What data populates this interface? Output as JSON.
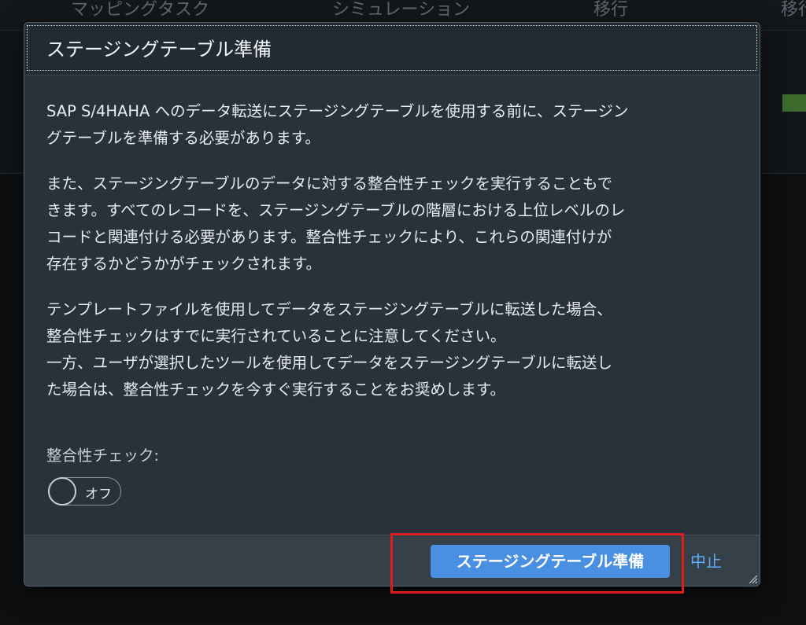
{
  "background": {
    "tabs": [
      "マッピングタスク",
      "シミュレーション",
      "移行",
      "移行"
    ]
  },
  "dialog": {
    "title": "ステージングテーブル準備",
    "paragraphs": [
      "SAP S/4HAHA へのデータ転送にステージングテーブルを使用する前に、ステージン\nグテーブルを準備する必要があります。",
      "また、ステージングテーブルのデータに対する整合性チェックを実行することもで\nきます。すべてのレコードを、ステージングテーブルの階層における上位レベルのレ\nコードと関連付ける必要があります。整合性チェックにより、これらの関連付けが\n存在するかどうかがチェックされます。",
      "テンプレートファイルを使用してデータをステージングテーブルに転送した場合、\n整合性チェックはすでに実行されていることに注意してください。\n一方、ユーザが選択したツールを使用してデータをステージングテーブルに転送し\nた場合は、整合性チェックを今すぐ実行することをお奨めします。"
    ],
    "consistency_check_label": "整合性チェック:",
    "toggle": {
      "state_label": "オフ",
      "on": false
    },
    "primary_button_label": "ステージングテーブル準備",
    "cancel_label": "中止"
  },
  "colors": {
    "primary": "#4a90e2",
    "link": "#5eaaf5",
    "highlight": "#e11c1c",
    "dialog_bg": "#29313a"
  }
}
